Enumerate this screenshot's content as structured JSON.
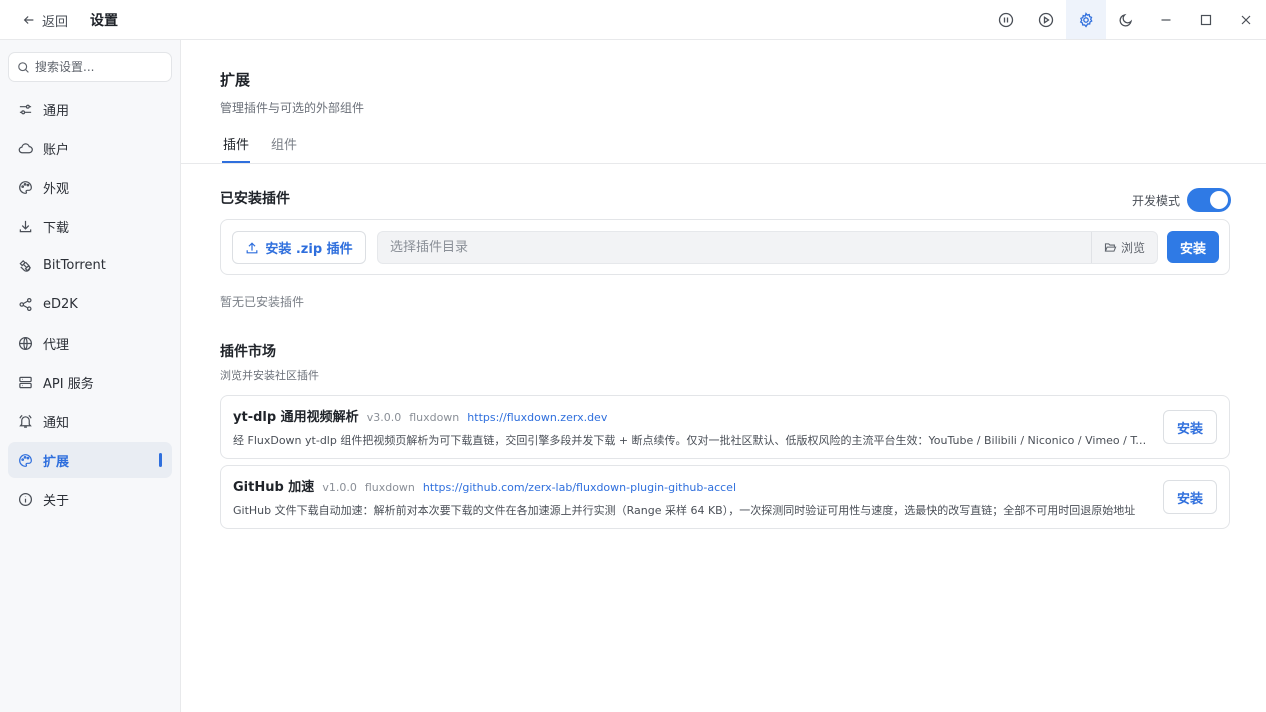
{
  "titlebar": {
    "back_label": "返回",
    "title": "设置",
    "buttons": [
      "pause-circle-icon",
      "play-circle-icon",
      "gear-icon",
      "moon-icon",
      "minimize-icon",
      "maximize-icon",
      "close-icon"
    ]
  },
  "sidebar": {
    "search_placeholder": "搜索设置...",
    "items": [
      {
        "label": "通用",
        "icon": "sliders-icon"
      },
      {
        "label": "账户",
        "icon": "cloud-icon"
      },
      {
        "label": "外观",
        "icon": "palette-icon"
      },
      {
        "label": "下载",
        "icon": "download-icon"
      },
      {
        "label": "BitTorrent",
        "icon": "magnet-icon"
      },
      {
        "label": "eD2K",
        "icon": "share-icon"
      },
      {
        "label": "代理",
        "icon": "globe-icon"
      },
      {
        "label": "API 服务",
        "icon": "server-icon"
      },
      {
        "label": "通知",
        "icon": "bell-icon"
      },
      {
        "label": "扩展",
        "icon": "puzzle-icon",
        "active": true
      },
      {
        "label": "关于",
        "icon": "info-icon"
      }
    ]
  },
  "main": {
    "title": "扩展",
    "subtitle": "管理插件与可选的外部组件",
    "tabs": [
      {
        "label": "插件",
        "active": true
      },
      {
        "label": "组件"
      }
    ],
    "installed": {
      "title": "已安装插件",
      "dev_mode_label": "开发模式",
      "dev_mode_on": true,
      "zip_button": "安装 .zip 插件",
      "dir_placeholder": "选择插件目录",
      "browse_label": "浏览",
      "install_label": "安装",
      "empty_text": "暂无已安装插件"
    },
    "market": {
      "title": "插件市场",
      "subtitle": "浏览并安装社区插件",
      "plugins": [
        {
          "name": "yt-dlp 通用视频解析",
          "version": "v3.0.0",
          "author": "fluxdown",
          "link": "https://fluxdown.zerx.dev",
          "description": "经 FluxDown yt-dlp 组件把视频页解析为可下载直链，交回引擎多段并发下载 + 断点续传。仅对一批社区默认、低版权风险的主流平台生效：YouTube / Bilibili / Niconico / Vimeo / Twitch",
          "button": "安装"
        },
        {
          "name": "GitHub 加速",
          "version": "v1.0.0",
          "author": "fluxdown",
          "link": "https://github.com/zerx-lab/fluxdown-plugin-github-accel",
          "description": "GitHub 文件下载自动加速：解析前对本次要下载的文件在各加速源上并行实测（Range 采样 64 KB），一次探测同时验证可用性与速度，选最快的改写直链；全部不可用时回退原始地址",
          "button": "安装"
        }
      ]
    }
  },
  "colors": {
    "accent": "#2f7ae5",
    "link": "#2f6fdd",
    "sidebar_bg": "#f7f8fa"
  }
}
